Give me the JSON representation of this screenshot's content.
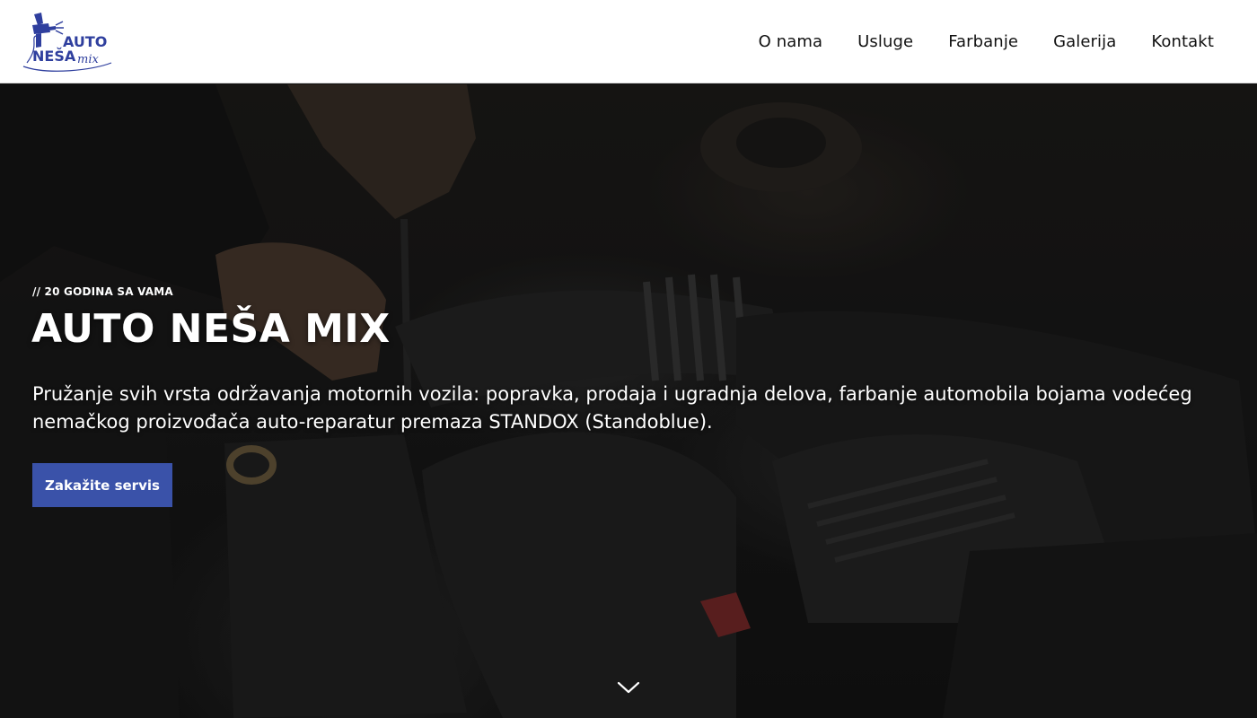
{
  "header": {
    "logo": {
      "line1": "AUTO",
      "line2": "NEŠA",
      "line3": "mix",
      "icon": "spray-gun-icon"
    },
    "nav": [
      {
        "label": "O nama"
      },
      {
        "label": "Usluge"
      },
      {
        "label": "Farbanje"
      },
      {
        "label": "Galerija"
      },
      {
        "label": "Kontakt"
      }
    ]
  },
  "hero": {
    "eyebrow": "// 20 GODINA SA VAMA",
    "title": "AUTO NEŠA MIX",
    "description": "Pružanje svih vrsta održavanja motornih vozila: popravka, prodaja i ugradnja delova, farbanje automobila bojama vodećeg nemačkog proizvođača auto-reparatur premaza STANDOX (Standoblue).",
    "cta_label": "Zakažite servis",
    "scroll_icon": "chevron-down-icon"
  },
  "colors": {
    "brand": "#2f3f9e",
    "cta": "#3a52a9",
    "nav_text": "#111111",
    "hero_text": "#ffffff"
  }
}
